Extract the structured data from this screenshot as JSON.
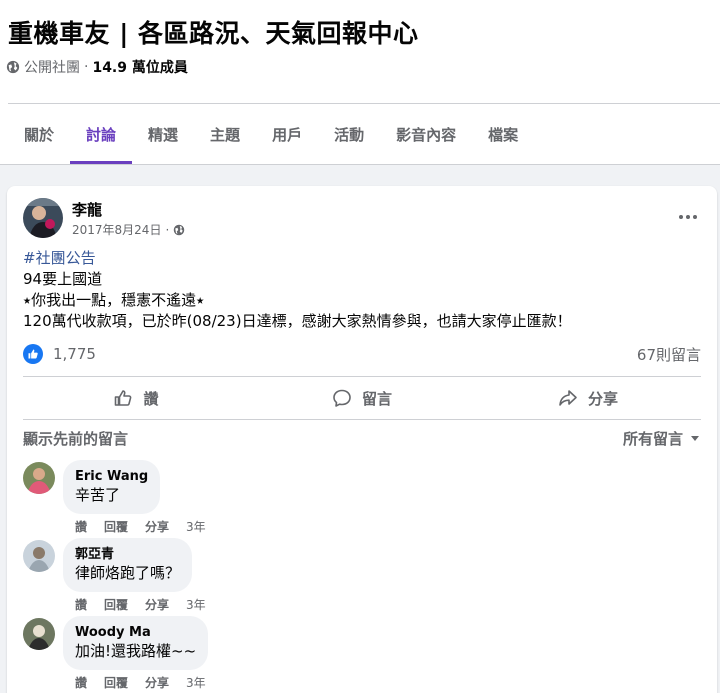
{
  "group": {
    "title": "重機車友 | 各區路況、天氣回報中心",
    "privacy": "公開社團",
    "separator": " · ",
    "members": "14.9 萬位成員"
  },
  "tabs": [
    {
      "label": "關於",
      "active": false
    },
    {
      "label": "討論",
      "active": true
    },
    {
      "label": "精選",
      "active": false
    },
    {
      "label": "主題",
      "active": false
    },
    {
      "label": "用戶",
      "active": false
    },
    {
      "label": "活動",
      "active": false
    },
    {
      "label": "影音內容",
      "active": false
    },
    {
      "label": "檔案",
      "active": false
    }
  ],
  "post": {
    "author": "李龍",
    "date": "2017年8月24日",
    "dot": " · ",
    "hashtag": "#社團公告",
    "lines": [
      "94要上國道",
      "⭑你我出一點，穩憲不遙遠⭑",
      "120萬代收款項，已於昨(08/23)日達標，感謝大家熱情參與，也請大家停止匯款！"
    ],
    "reactions_count": "1,775",
    "comments_count": "67則留言",
    "actions": {
      "like": "讚",
      "comment": "留言",
      "share": "分享"
    }
  },
  "comments_section": {
    "show_previous": "顯示先前的留言",
    "filter": "所有留言"
  },
  "comments": [
    {
      "name": "Eric Wang",
      "text": "辛苦了",
      "like": "讚",
      "reply": "回覆",
      "share": "分享",
      "time": "3年"
    },
    {
      "name": "郭亞青",
      "text": "律師烙跑了嗎？",
      "like": "讚",
      "reply": "回覆",
      "share": "分享",
      "time": "3年"
    },
    {
      "name": "Woody Ma",
      "text": "加油!還我路權~~",
      "like": "讚",
      "reply": "回覆",
      "share": "分享",
      "time": "3年"
    }
  ],
  "colors": {
    "accent": "#6a3fbf",
    "like_blue": "#1877f2",
    "hashtag": "#385898",
    "secondary_text": "#65676b",
    "bubble_bg": "#f0f2f5"
  }
}
